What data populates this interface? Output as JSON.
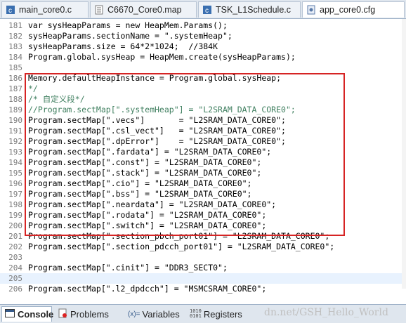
{
  "tabs": [
    {
      "label": "main_core0.c",
      "icon": "c-file-icon",
      "active": false
    },
    {
      "label": "C6670_Core0.map",
      "icon": "text-file-icon",
      "active": false
    },
    {
      "label": "TSK_L1Schedule.c",
      "icon": "c-file-icon",
      "active": false
    },
    {
      "label": "app_core0.cfg",
      "icon": "cfg-file-icon",
      "active": true
    }
  ],
  "editor": {
    "lines": [
      {
        "n": "181",
        "text": "var sysHeapParams = new HeapMem.Params();"
      },
      {
        "n": "182",
        "text": "sysHeapParams.sectionName = \".systemHeap\";"
      },
      {
        "n": "183",
        "text": "sysHeapParams.size = 64*2*1024;  //384K"
      },
      {
        "n": "184",
        "text": "Program.global.sysHeap = HeapMem.create(sysHeapParams);"
      },
      {
        "n": "185",
        "text": ""
      },
      {
        "n": "186",
        "text": "Memory.defaultHeapInstance = Program.global.sysHeap;"
      },
      {
        "n": "187",
        "text": "*/"
      },
      {
        "n": "188",
        "text": "/* 自定义段*/"
      },
      {
        "n": "189",
        "text": "//Program.sectMap[\".systemHeap\"] = \"L2SRAM_DATA_CORE0\";"
      },
      {
        "n": "190",
        "text": "Program.sectMap[\".vecs\"]       = \"L2SRAM_DATA_CORE0\";"
      },
      {
        "n": "191",
        "text": "Program.sectMap[\".csl_vect\"]   = \"L2SRAM_DATA_CORE0\";"
      },
      {
        "n": "192",
        "text": "Program.sectMap[\".dpError\"]    = \"L2SRAM_DATA_CORE0\";"
      },
      {
        "n": "193",
        "text": "Program.sectMap[\".fardata\"] = \"L2SRAM_DATA_CORE0\";"
      },
      {
        "n": "194",
        "text": "Program.sectMap[\".const\"] = \"L2SRAM_DATA_CORE0\";"
      },
      {
        "n": "195",
        "text": "Program.sectMap[\".stack\"] = \"L2SRAM_DATA_CORE0\";"
      },
      {
        "n": "196",
        "text": "Program.sectMap[\".cio\"] = \"L2SRAM_DATA_CORE0\";"
      },
      {
        "n": "197",
        "text": "Program.sectMap[\".bss\"] = \"L2SRAM_DATA_CORE0\";"
      },
      {
        "n": "198",
        "text": "Program.sectMap[\".neardata\"] = \"L2SRAM_DATA_CORE0\";"
      },
      {
        "n": "199",
        "text": "Program.sectMap[\".rodata\"] = \"L2SRAM_DATA_CORE0\";"
      },
      {
        "n": "200",
        "text": "Program.sectMap[\".switch\"] = \"L2SRAM_DATA_CORE0\";"
      },
      {
        "n": "201",
        "text": "Program.sectMap[\".section_pbch_port01\"] = \"L2SRAM_DATA_CORE0\";"
      },
      {
        "n": "202",
        "text": "Program.sectMap[\".section_pdcch_port01\"] = \"L2SRAM_DATA_CORE0\";"
      },
      {
        "n": "203",
        "text": ""
      },
      {
        "n": "204",
        "text": "Program.sectMap[\".cinit\"] = \"DDR3_SECT0\";"
      },
      {
        "n": "205",
        "text": ""
      },
      {
        "n": "206",
        "text": "Program.sectMap[\".l2_dpdcch\"] = \"MSMCSRAM_CORE0\";"
      }
    ]
  },
  "bottom_tabs": [
    {
      "label": "Console",
      "icon": "console-icon",
      "active": true
    },
    {
      "label": "Problems",
      "icon": "problems-icon",
      "active": false
    },
    {
      "label": "Variables",
      "icon": "variables-icon",
      "active": false
    },
    {
      "label": "Registers",
      "icon": "registers-icon",
      "active": false
    }
  ],
  "watermark": "dn.net/GSH_Hello_World",
  "colors": {
    "highlight_box": "#d62424",
    "comment": "#3f7f5f",
    "string": "#2a00ff"
  }
}
